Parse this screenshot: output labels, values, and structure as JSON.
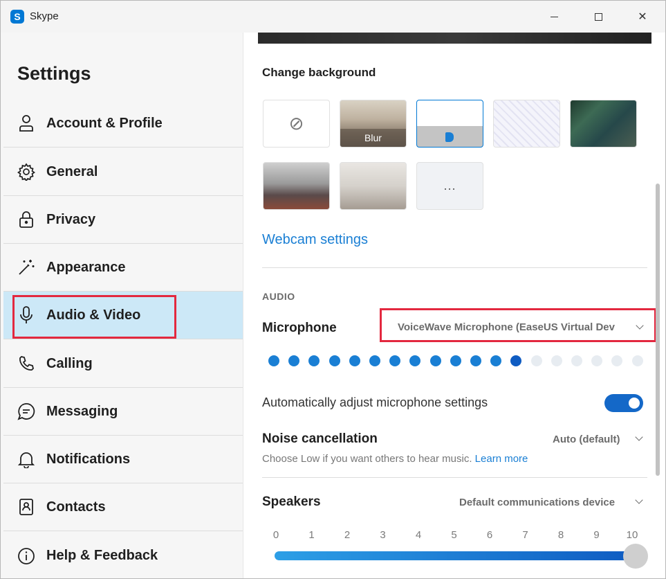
{
  "window": {
    "app_name": "Skype",
    "logo_letter": "S",
    "controls": {
      "minimize": "—",
      "maximize": "☐",
      "close": "✕"
    }
  },
  "sidebar": {
    "title": "Settings",
    "items": [
      {
        "label": "Account & Profile",
        "icon": "person-icon"
      },
      {
        "label": "General",
        "icon": "gear-icon"
      },
      {
        "label": "Privacy",
        "icon": "lock-icon"
      },
      {
        "label": "Appearance",
        "icon": "magic-wand-icon"
      },
      {
        "label": "Audio & Video",
        "icon": "microphone-icon",
        "active": true
      },
      {
        "label": "Calling",
        "icon": "phone-icon"
      },
      {
        "label": "Messaging",
        "icon": "chat-icon"
      },
      {
        "label": "Notifications",
        "icon": "bell-icon"
      },
      {
        "label": "Contacts",
        "icon": "contact-card-icon"
      },
      {
        "label": "Help & Feedback",
        "icon": "info-icon"
      }
    ]
  },
  "content": {
    "change_background_label": "Change background",
    "backgrounds": {
      "none_icon": "⊘",
      "blur_label": "Blur",
      "more_label": "..."
    },
    "webcam_settings_link": "Webcam settings",
    "audio_header": "AUDIO",
    "microphone": {
      "label": "Microphone",
      "selected": "VoiceWave Microphone (EaseUS Virtual Dev"
    },
    "mic_level": {
      "total_dots": 19,
      "active_dots": 13,
      "active_color": "#1a7fd4",
      "last_active_color": "#0f5cc2",
      "inactive_color": "#e7ecf1"
    },
    "auto_adjust": {
      "label": "Automatically adjust microphone settings",
      "enabled": true
    },
    "noise_cancellation": {
      "label": "Noise cancellation",
      "selected": "Auto (default)",
      "hint": "Choose Low if you want others to hear music.",
      "learn_more": "Learn more"
    },
    "speakers": {
      "label": "Speakers",
      "selected": "Default communications device",
      "ticks": [
        "0",
        "1",
        "2",
        "3",
        "4",
        "5",
        "6",
        "7",
        "8",
        "9",
        "10"
      ],
      "volume": 10
    }
  },
  "colors": {
    "accent": "#1a7fd4",
    "highlight_box": "#e3283f",
    "active_nav": "#cce8f7"
  }
}
